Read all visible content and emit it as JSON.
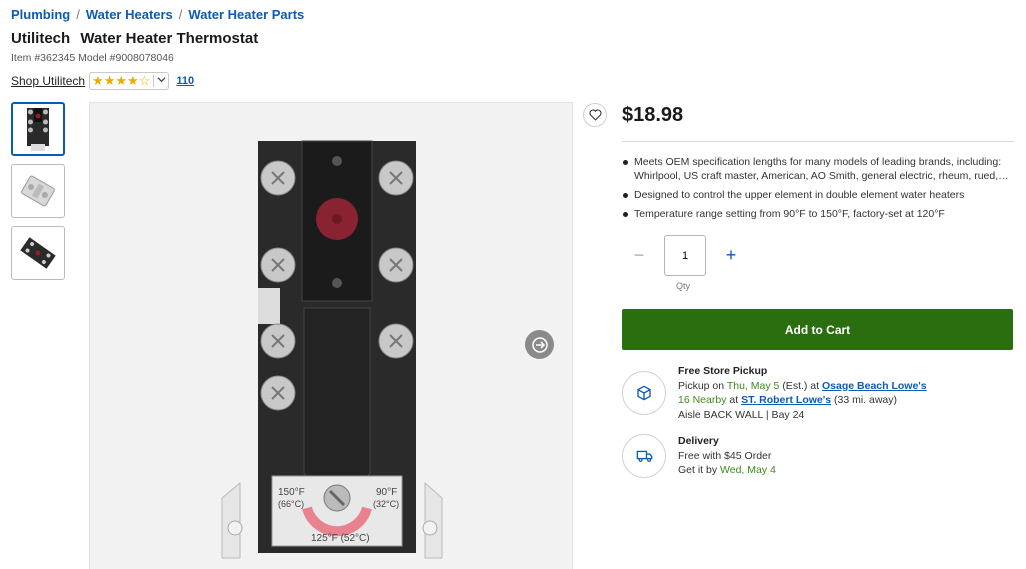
{
  "breadcrumb": [
    "Plumbing",
    "Water Heaters",
    "Water Heater Parts"
  ],
  "product": {
    "brand": "Utilitech",
    "name": "Water Heater Thermostat",
    "item_label": "Item #362345",
    "model_label": "Model #9008078046",
    "shop_link": "Shop Utilitech",
    "rating": 3.5,
    "review_count": "110",
    "price": "$18.98"
  },
  "bullets": [
    "Meets OEM specification lengths for many models of leading brands, including: Whirlpool, US craft master, American, AO Smith, general electric, rheum, rued, and more",
    "Designed to control the upper element in double element water heaters",
    "Temperature range setting from 90°F to 150°F, factory-set at 120°F"
  ],
  "quantity": {
    "value": "1",
    "label": "Qty",
    "minus": "−",
    "plus": "+"
  },
  "add_to_cart": "Add to Cart",
  "pickup": {
    "title": "Free Store Pickup",
    "line1_prefix": "Pickup on",
    "line1_date": "Thu, May 5",
    "line1_mid": "(Est.) at",
    "line1_store": "Osage Beach Lowe's",
    "line2_nearby": "16 Nearby",
    "line2_at": "at",
    "line2_store": "ST. Robert Lowe's",
    "line2_dist": "(33 mi. away)",
    "aisle": "Aisle BACK WALL | Bay 24"
  },
  "delivery": {
    "title": "Delivery",
    "line1": "Free with $45 Order",
    "line2_prefix": "Get it by",
    "line2_date": "Wed, May 4"
  },
  "thermostat_labels": {
    "left_temp": "150°F",
    "left_temp_c": "(66°C)",
    "right_temp": "90°F",
    "right_temp_c": "(32°C)",
    "bottom_temp": "125°F (52°C)"
  },
  "colors": {
    "link_blue": "#0b5bb5",
    "cart_green": "#2b6e0f",
    "date_green": "#3e8a1c",
    "star_gold": "#f2a900"
  }
}
